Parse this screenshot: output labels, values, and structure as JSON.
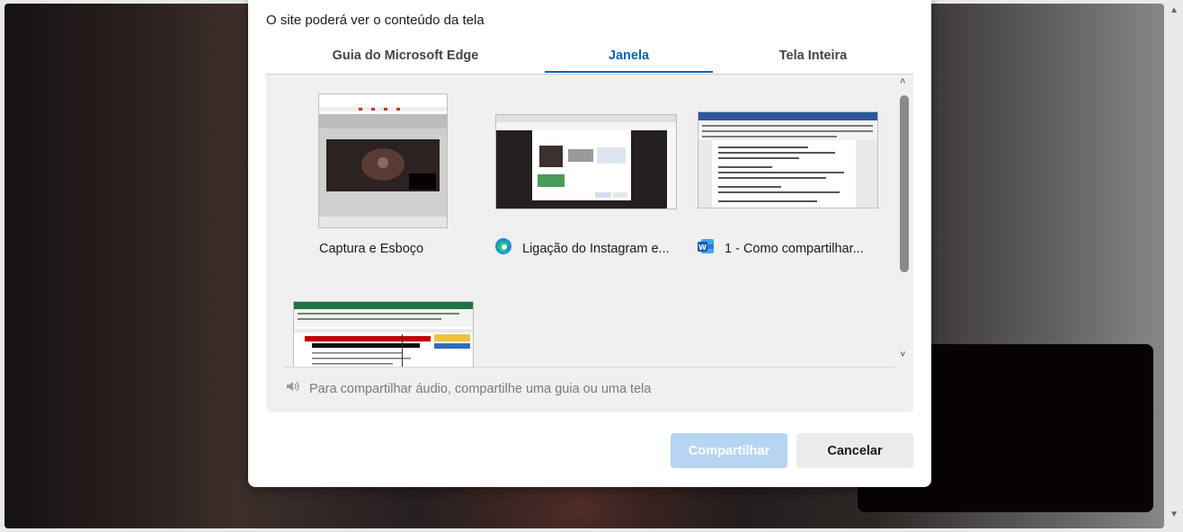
{
  "dialog": {
    "subtitle": "O site poderá ver o conteúdo da tela",
    "tabs": [
      {
        "label": "Guia do Microsoft Edge",
        "selected": false
      },
      {
        "label": "Janela",
        "selected": true
      },
      {
        "label": "Tela Inteira",
        "selected": false
      }
    ],
    "windows": [
      {
        "label": "Captura e Esboço",
        "icon": "none"
      },
      {
        "label": "Ligação do Instagram e...",
        "icon": "edge-icon"
      },
      {
        "label": "1 - Como compartilhar...",
        "icon": "word-icon"
      },
      {
        "label": "",
        "icon": "excel-window"
      }
    ],
    "audio_note": "Para compartilhar áudio, compartilhe uma guia ou uma tela",
    "buttons": {
      "share": "Compartilhar",
      "cancel": "Cancelar"
    }
  },
  "colors": {
    "accent": "#0b62c4",
    "share_disabled": "#b5d5f3"
  }
}
